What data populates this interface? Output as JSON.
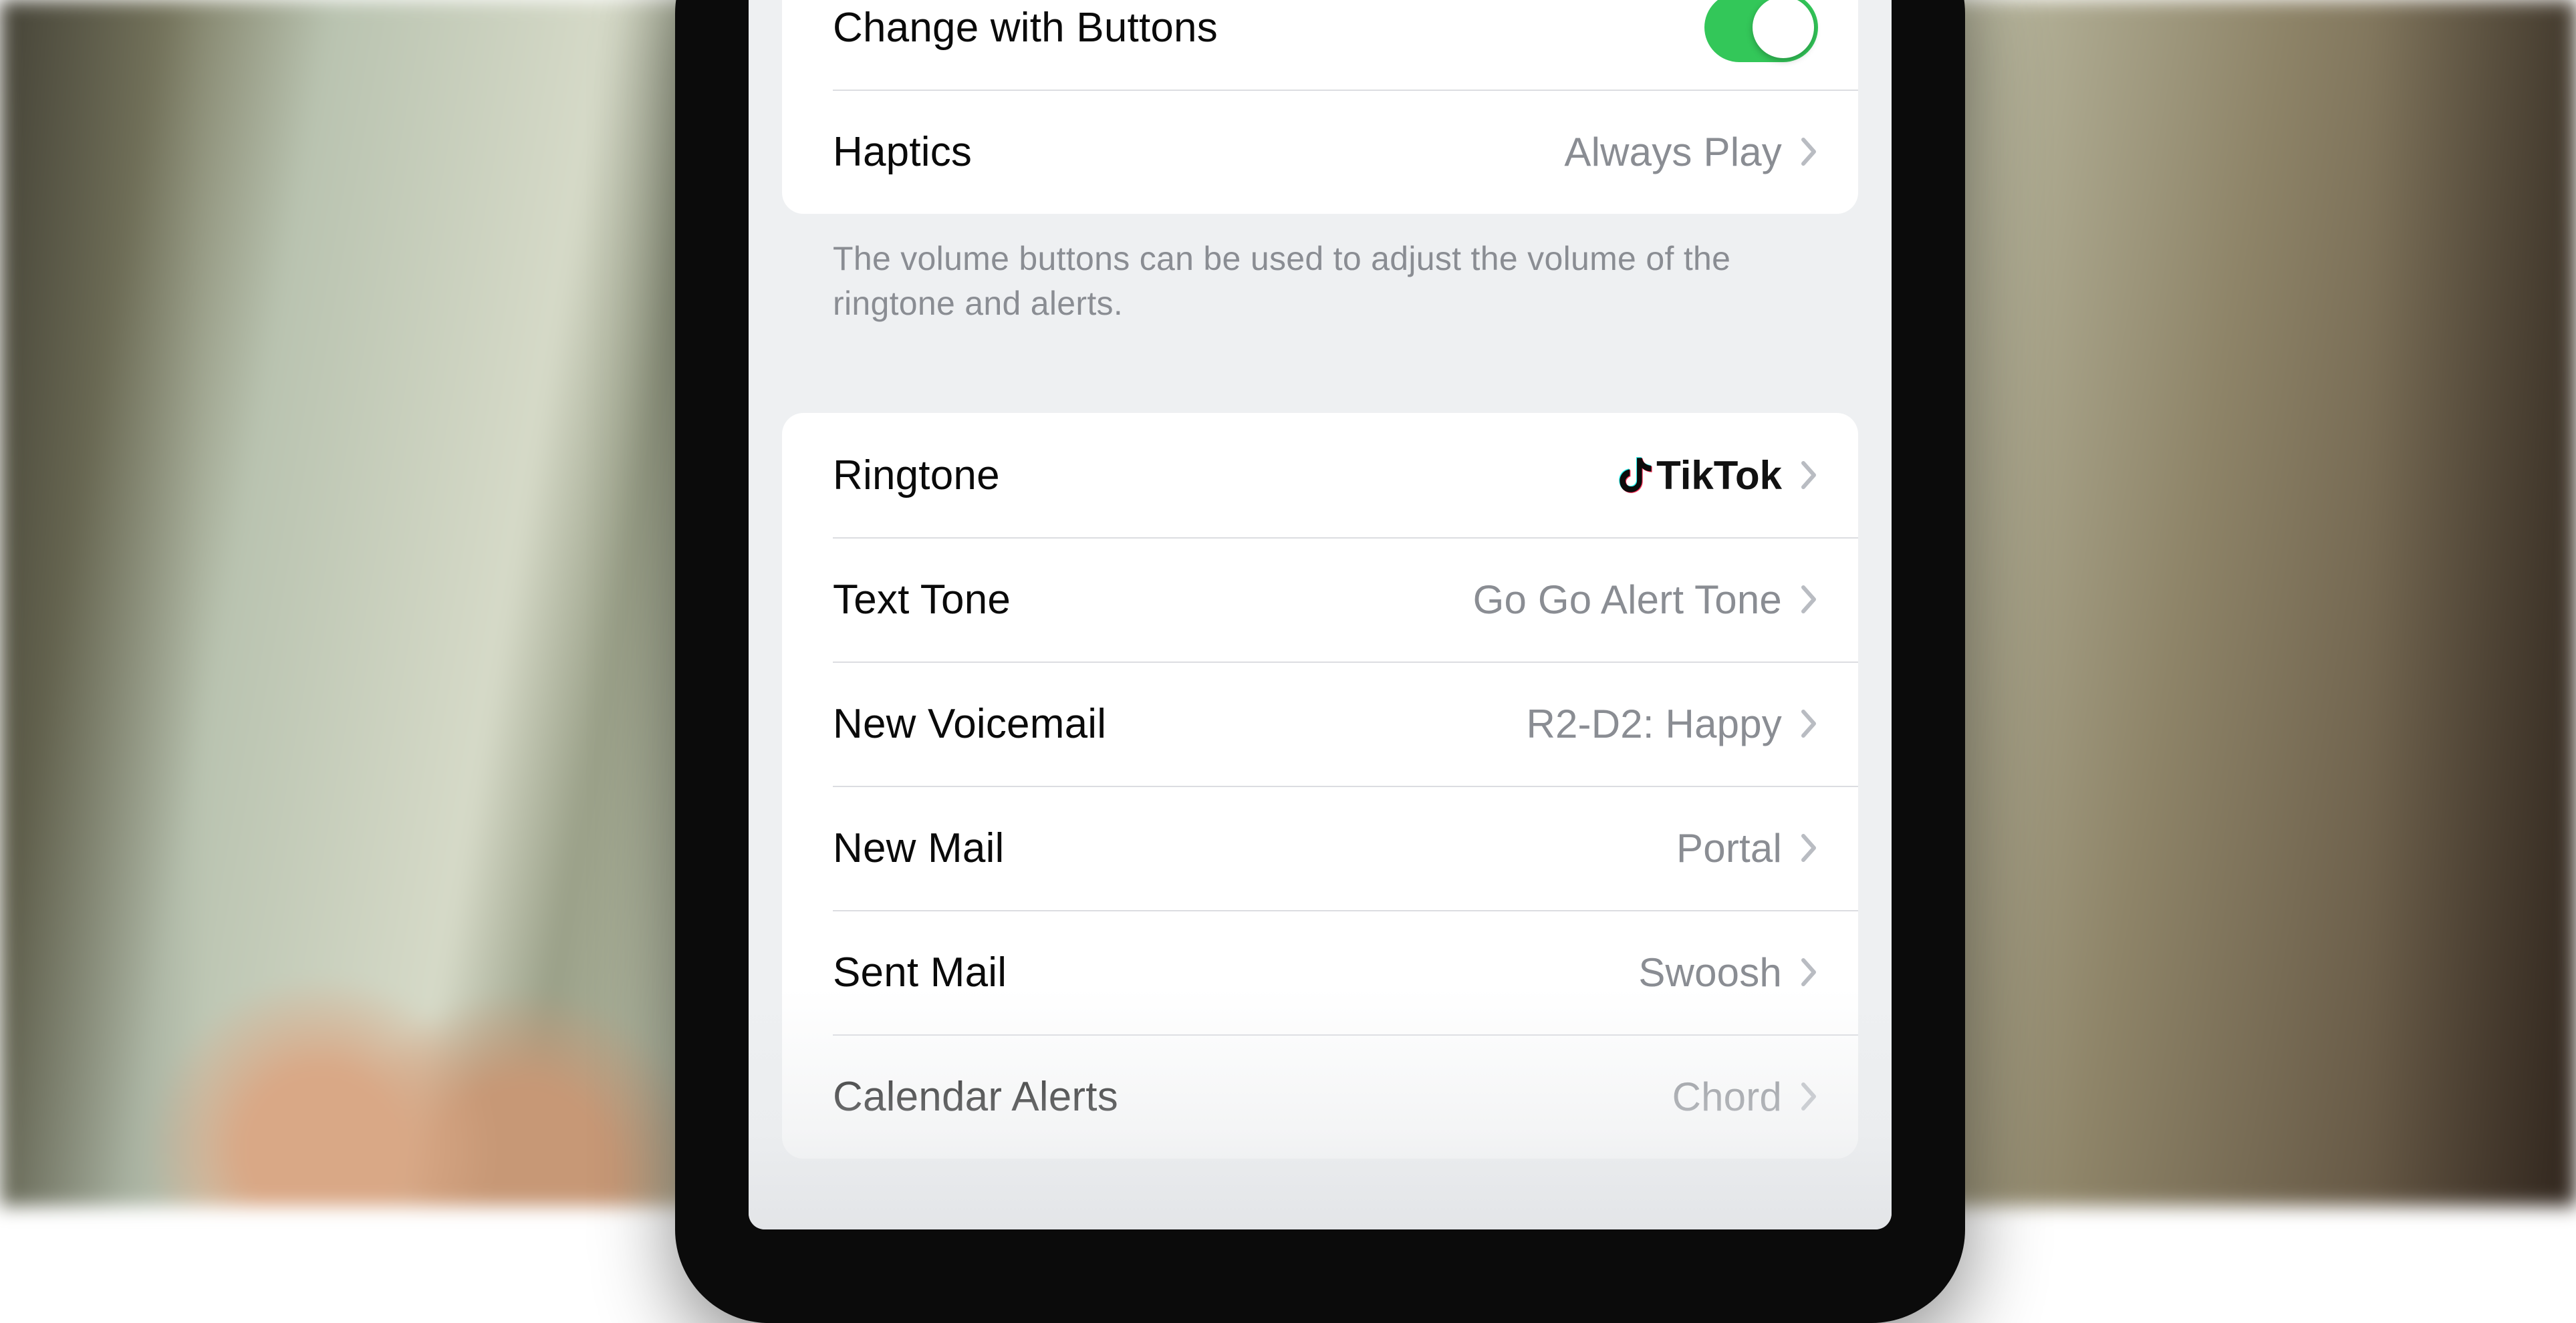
{
  "section1": {
    "change_with_buttons": {
      "label": "Change with Buttons",
      "on": true
    },
    "haptics": {
      "label": "Haptics",
      "value": "Always Play"
    },
    "footnote": "The volume buttons can be used to adjust the volume of the ringtone and alerts."
  },
  "section2": {
    "ringtone": {
      "label": "Ringtone",
      "value": "TikTok"
    },
    "text_tone": {
      "label": "Text Tone",
      "value": "Go Go Alert Tone"
    },
    "new_voicemail": {
      "label": "New Voicemail",
      "value": "R2-D2: Happy"
    },
    "new_mail": {
      "label": "New Mail",
      "value": "Portal"
    },
    "sent_mail": {
      "label": "Sent Mail",
      "value": "Swoosh"
    },
    "calendar_alerts": {
      "label": "Calendar Alerts",
      "value": "Chord"
    }
  }
}
